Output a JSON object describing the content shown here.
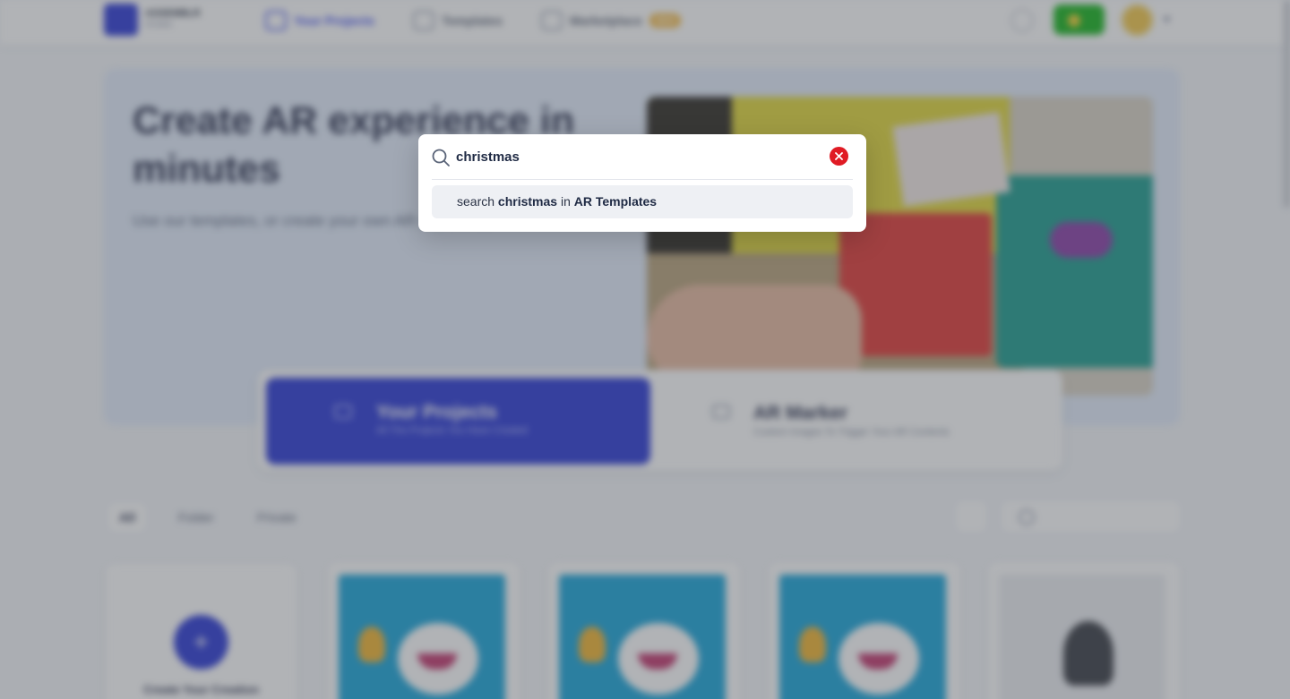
{
  "topbar": {
    "logo_name": "ASSEMBLR",
    "logo_sub": "STUDIO",
    "nav": [
      {
        "label": "Your Projects",
        "icon": "folder-icon",
        "active": true
      },
      {
        "label": "Templates",
        "icon": "templates-icon",
        "active": false
      },
      {
        "label": "Marketplace",
        "icon": "marketplace-icon",
        "active": false,
        "badge": "NEW"
      }
    ],
    "icons": [
      "search-icon",
      "upgrade-icon",
      "avatar",
      "chevron-down-icon"
    ]
  },
  "hero": {
    "title": "Create AR experience in minutes",
    "subtitle": "Use our templates, or create your own AR experience"
  },
  "feature_cards": [
    {
      "title": "Your Projects",
      "subtitle": "All The Projects You Have Created"
    },
    {
      "title": "AR Marker",
      "subtitle": "Custom Images To Trigger Your AR Contents"
    }
  ],
  "filters": {
    "tabs": [
      "All",
      "Folder",
      "Private"
    ],
    "active_tab": "All",
    "search_placeholder": ""
  },
  "grid": {
    "create_label": "Create Your Creation",
    "create_plus": "+"
  },
  "search_modal": {
    "query": "christmas",
    "suggestion": {
      "prefix": "search",
      "query": "christmas",
      "middle": "in",
      "target": "AR Templates"
    },
    "clear_icon": "close-icon",
    "colors": {
      "clear_button": "#e01b24",
      "suggestion_bg": "#eef0f4"
    }
  }
}
